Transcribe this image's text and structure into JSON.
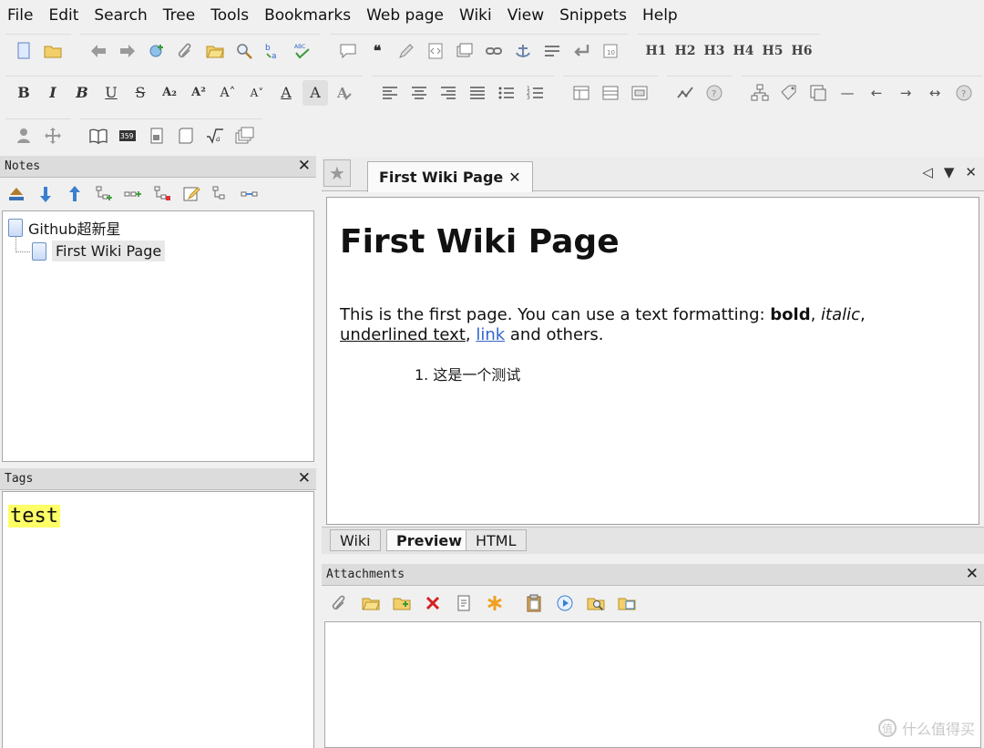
{
  "menu": [
    "File",
    "Edit",
    "Search",
    "Tree",
    "Tools",
    "Bookmarks",
    "Web page",
    "Wiki",
    "View",
    "Snippets",
    "Help"
  ],
  "toolbar": {
    "headings": [
      "H1",
      "H2",
      "H3",
      "H4",
      "H5",
      "H6"
    ],
    "format_bold": "B",
    "format_italic": "I",
    "format_bold_alt": "B",
    "format_underline": "U",
    "format_strike": "S",
    "format_sub": "A₂",
    "format_sup": "A²",
    "font_bigger": "A˄",
    "font_smaller": "A˅",
    "font_color": "A",
    "highlight": "A"
  },
  "notes_panel": {
    "title": "Notes",
    "close": "✕",
    "tree": [
      {
        "label": "Github超新星"
      },
      {
        "label": "First Wiki Page"
      }
    ]
  },
  "tags_panel": {
    "title": "Tags",
    "close": "✕",
    "tags": [
      "test"
    ]
  },
  "editor": {
    "tab_title": "First Wiki Page",
    "tab_close": "✕",
    "nav_prev": "◁",
    "nav_menu": "▼",
    "nav_close": "✕",
    "heading": "First Wiki Page",
    "paragraph": {
      "intro": "This is the first page. You can use a text formatting: ",
      "bold": "bold",
      "sep1": ", ",
      "italic": "italic",
      "sep2": ",",
      "underlined": "underlined text",
      "sep3": ", ",
      "link": "link",
      "outro": " and others."
    },
    "list_number": "1.",
    "list_text": "这是一个测试",
    "view_tabs": [
      "Wiki",
      "Preview",
      "HTML"
    ],
    "active_view": "Preview"
  },
  "attachments_panel": {
    "title": "Attachments",
    "close": "✕"
  },
  "watermark": {
    "symbol": "值",
    "text": "什么值得买"
  }
}
